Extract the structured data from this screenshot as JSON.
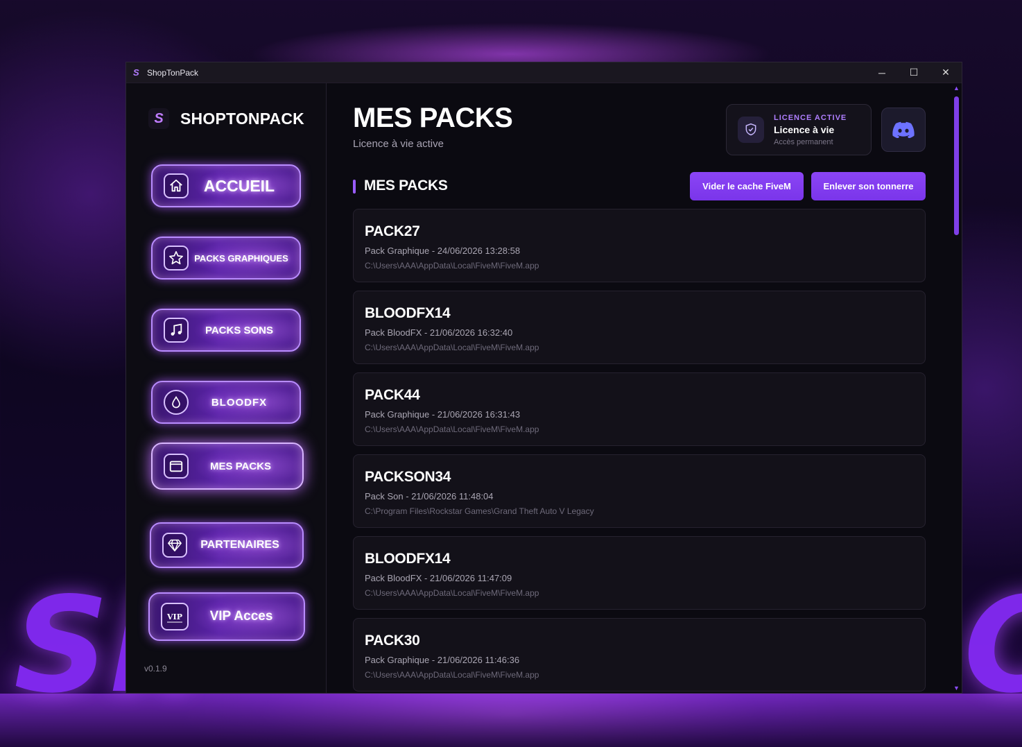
{
  "window": {
    "title": "ShopTonPack",
    "controls": {
      "minimize": "─",
      "maximize": "☐",
      "close": "✕"
    }
  },
  "background": {
    "left_letters": "Sh",
    "right_letters": "C"
  },
  "sidebar": {
    "brand": "SHOPTONPACK",
    "logo": "S",
    "items": [
      {
        "label": "ACCUEIL",
        "icon": "home-icon"
      },
      {
        "label": "PACKS GRAPHIQUES",
        "icon": "star-icon"
      },
      {
        "label": "PACKS SONS",
        "icon": "music-note-icon"
      },
      {
        "label": "BLOODFX",
        "icon": "blood-drop-icon"
      },
      {
        "label": "MES PACKS",
        "icon": "folder-icon",
        "active": true
      },
      {
        "label": "PARTENAIRES",
        "icon": "diamond-icon"
      },
      {
        "label": "VIP Acces",
        "icon": "vip-badge-icon"
      }
    ],
    "version": "v0.1.9"
  },
  "header": {
    "title": "MES PACKS",
    "subtitle": "Licence à vie active"
  },
  "license": {
    "kicker": "LICENCE ACTIVE",
    "title": "Licence à vie",
    "subtitle": "Accès permanent",
    "icon": "shield-check-icon"
  },
  "discord": {
    "icon": "discord-icon"
  },
  "section": {
    "title": "MES PACKS",
    "buttons": {
      "clear_cache": "Vider le cache FiveM",
      "remove_thunder": "Enlever son tonnerre"
    }
  },
  "packs": [
    {
      "name": "PACK27",
      "meta": "Pack Graphique - 24/06/2026 13:28:58",
      "path": "C:\\Users\\AAA\\AppData\\Local\\FiveM\\FiveM.app"
    },
    {
      "name": "BLOODFX14",
      "meta": "Pack BloodFX - 21/06/2026 16:32:40",
      "path": "C:\\Users\\AAA\\AppData\\Local\\FiveM\\FiveM.app"
    },
    {
      "name": "PACK44",
      "meta": "Pack Graphique - 21/06/2026 16:31:43",
      "path": "C:\\Users\\AAA\\AppData\\Local\\FiveM\\FiveM.app"
    },
    {
      "name": "PACKSON34",
      "meta": "Pack Son - 21/06/2026 11:48:04",
      "path": "C:\\Program Files\\Rockstar Games\\Grand Theft Auto V Legacy"
    },
    {
      "name": "BLOODFX14",
      "meta": "Pack BloodFX - 21/06/2026 11:47:09",
      "path": "C:\\Users\\AAA\\AppData\\Local\\FiveM\\FiveM.app"
    },
    {
      "name": "PACK30",
      "meta": "Pack Graphique - 21/06/2026 11:46:36",
      "path": "C:\\Users\\AAA\\AppData\\Local\\FiveM\\FiveM.app"
    }
  ],
  "colors": {
    "accent": "#8b45f5",
    "window_bg": "#0b0a11",
    "card_bg": "#131119",
    "kicker": "#b07fff"
  }
}
